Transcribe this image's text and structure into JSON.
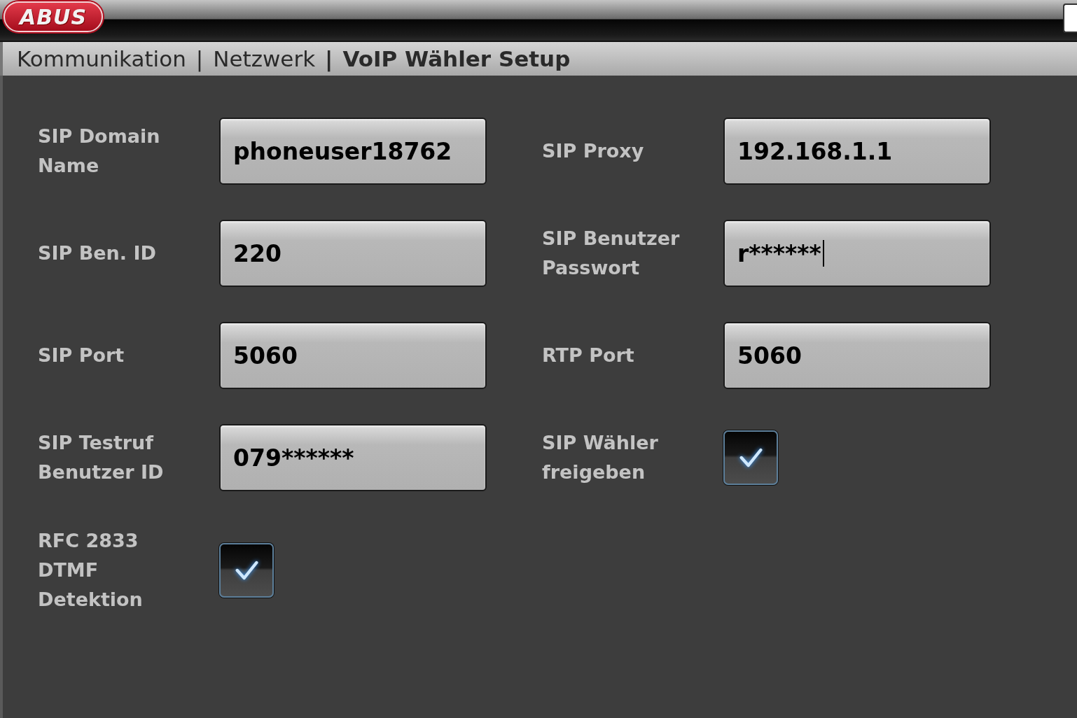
{
  "logo": "ABUS",
  "breadcrumb": {
    "separator": "|",
    "items": [
      {
        "label": "Kommunikation",
        "selected": false
      },
      {
        "label": "Netzwerk",
        "selected": false
      },
      {
        "label": "VoIP Wähler Setup",
        "selected": true
      }
    ]
  },
  "rows": [
    {
      "fields": [
        {
          "label": "SIP Domain Name",
          "kind": "text",
          "value": "phoneuser18762"
        },
        {
          "label": "SIP Proxy",
          "kind": "text",
          "value": "192.168.1.1"
        }
      ]
    },
    {
      "fields": [
        {
          "label": "SIP Ben. ID",
          "kind": "text",
          "value": "220"
        },
        {
          "label": "SIP Benutzer Passwort",
          "kind": "text",
          "value": "r******",
          "focused": true
        }
      ]
    },
    {
      "fields": [
        {
          "label": "SIP Port",
          "kind": "text",
          "value": "5060"
        },
        {
          "label": "RTP Port",
          "kind": "text",
          "value": "5060"
        }
      ]
    },
    {
      "fields": [
        {
          "label": "SIP Testruf Benutzer ID",
          "kind": "text",
          "value": "079******"
        },
        {
          "label": "SIP Wähler freigeben",
          "kind": "checkbox",
          "checked": true
        }
      ]
    },
    {
      "fields": [
        {
          "label": "RFC 2833 DTMF Detektion",
          "kind": "checkbox",
          "checked": true
        }
      ]
    }
  ]
}
